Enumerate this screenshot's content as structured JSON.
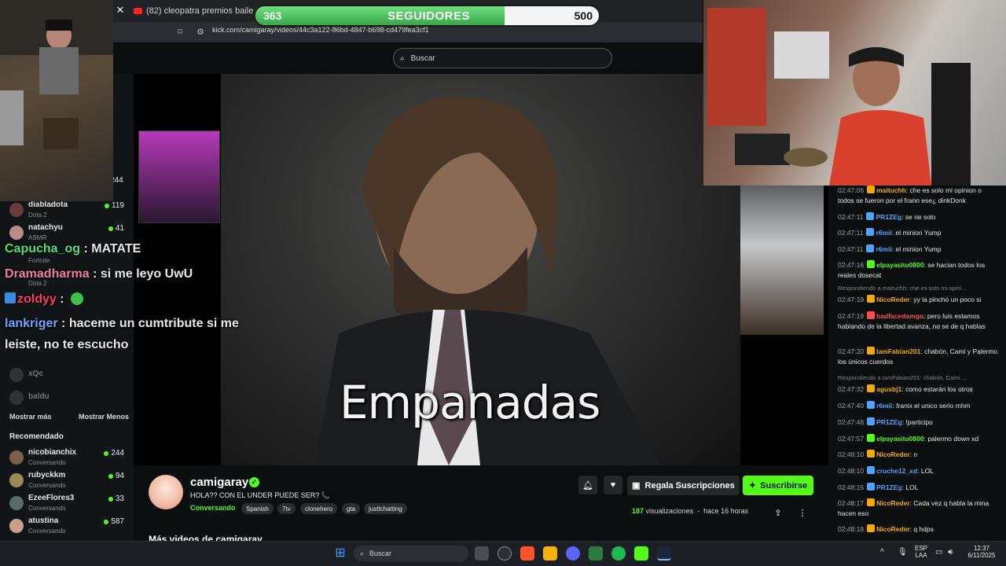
{
  "browser": {
    "tab_title": "(82) cleopatra premios baile - YouTube",
    "url": "kick.com/camigaray/videos/44c3a122-86bd-4847-b698-cd479fea3cf1"
  },
  "goal": {
    "current": "363",
    "label": "SEGUIDORES",
    "max": "500",
    "progress": 0.726
  },
  "header": {
    "search_placeholder": "Buscar"
  },
  "sidebar": {
    "top_count": "244",
    "following": [
      {
        "name": "diabladota",
        "game": "Dota 2",
        "viewers": "119"
      },
      {
        "name": "natachyu",
        "game": "ASMR",
        "viewers": "41"
      },
      {
        "name": "",
        "game": "Fortnite",
        "viewers": ""
      },
      {
        "name": "",
        "game": "Dota 2",
        "viewers": ""
      }
    ],
    "offline": [
      {
        "name": "xQc"
      },
      {
        "name": "baldu"
      }
    ],
    "show_more": "Mostrar más",
    "show_less": "Mostrar Menos",
    "recommended_label": "Recomendado",
    "recommended": [
      {
        "name": "nicobianchix",
        "status": "Conversando",
        "viewers": "244"
      },
      {
        "name": "rubyckkm",
        "status": "Conversando",
        "viewers": "94"
      },
      {
        "name": "EzeeFlores3",
        "status": "Conversando",
        "viewers": "33"
      },
      {
        "name": "atustina",
        "status": "Conversando",
        "viewers": "587"
      }
    ]
  },
  "overlay_chat": [
    {
      "user": "Capucha_og",
      "sep": " : ",
      "text": "MATATE",
      "color": "#4fe07a"
    },
    {
      "user": "Dramadharma",
      "sep": " : ",
      "text": "si me leyo UwU",
      "color": "#f07ea7"
    },
    {
      "user": "zoldyy",
      "sep": " : ",
      "text": "",
      "color": "#ff3a6a"
    },
    {
      "user": "lankriger",
      "sep": " : ",
      "text": "haceme un cumtribute si me",
      "color": "#6aa8ff"
    },
    {
      "user": "",
      "sep": "",
      "text": "leiste, no te escucho",
      "color": "#ffffff"
    }
  ],
  "video": {
    "caption": "Empanadas"
  },
  "channel": {
    "name": "camigaray",
    "title": "HOLA?? CON EL UNDER PUEDE SER? 📞",
    "category": "Conversando",
    "tags": [
      "Spanish",
      "7tv",
      "clonehero",
      "gta",
      "justtchatting"
    ],
    "gift_label": "Regala Suscripciones",
    "subscribe_label": "Suscribirse",
    "views_count": "187",
    "views_label": "visualizaciones",
    "age": "hace 16 horas",
    "more_videos": "Más videos de camigaray"
  },
  "chat": [
    {
      "time": "02:47:06",
      "user": "maituchh",
      "color": "#f2a900",
      "text": "che es solo mi opinion o todos se fueron por el frann ese¿ dinkDonk"
    },
    {
      "time": "02:47:11",
      "user": "PR1ZEg",
      "color": "#4fa3ff",
      "text": "se rie solo"
    },
    {
      "time": "02:47:11",
      "user": "r6mii",
      "color": "#4fa3ff",
      "text": "el minion Yump"
    },
    {
      "time": "02:47:11",
      "user": "r6mii",
      "color": "#4fa3ff",
      "text": "el minion Yump"
    },
    {
      "time": "02:47:16",
      "user": "elpayasito0800",
      "color": "#53fc18",
      "text": "se hacian todos los reales dosecat"
    },
    {
      "reply": "Respondiendo a maituchh: che es solo mi opini..."
    },
    {
      "time": "02:47:19",
      "user": "NicoReder",
      "color": "#f2a900",
      "text": "yy la pinchó un poco si"
    },
    {
      "time": "02:47:19",
      "user": "badfacedamgo",
      "color": "#ff4d4d",
      "text": "pero luis estamos hablando de la libertad avanza, no se de q hablas"
    },
    {
      "time": "02:47:20",
      "user": "IamFabian201",
      "color": "#f2a900",
      "text": "chabón, Cami y Palermo los únicos cuerdos"
    },
    {
      "reply": "Respondiendo a IamFabian201: chabón, Cami ..."
    },
    {
      "time": "02:47:32",
      "user": "agusbj1",
      "color": "#f2a900",
      "text": "como estarán los otros"
    },
    {
      "time": "02:47:40",
      "user": "r6mii",
      "color": "#4fa3ff",
      "text": "franix el unico serio mhm"
    },
    {
      "time": "02:47:48",
      "user": "PR1ZEg",
      "color": "#4fa3ff",
      "text": "!participo"
    },
    {
      "time": "02:47:57",
      "user": "elpayasito0800",
      "color": "#53fc18",
      "text": "palermo down xd"
    },
    {
      "time": "02:48:10",
      "user": "NicoReder",
      "color": "#f2a900",
      "text": "n"
    },
    {
      "time": "02:48:10",
      "user": "cruche12_xd",
      "color": "#4fa3ff",
      "text": "LOL"
    },
    {
      "time": "02:48:15",
      "user": "PR1ZEg",
      "color": "#4fa3ff",
      "text": "LOL"
    },
    {
      "time": "02:48:17",
      "user": "NicoReder",
      "color": "#f2a900",
      "text": "Cada vez q habla la mina hacen eso"
    },
    {
      "time": "02:48:18",
      "user": "NicoReder",
      "color": "#f2a900",
      "text": "q hdps"
    }
  ],
  "taskbar": {
    "search": "Buscar",
    "lang_top": "ESP",
    "lang_bottom": "LAA",
    "time": "12:37",
    "date": "6/11/2025"
  }
}
